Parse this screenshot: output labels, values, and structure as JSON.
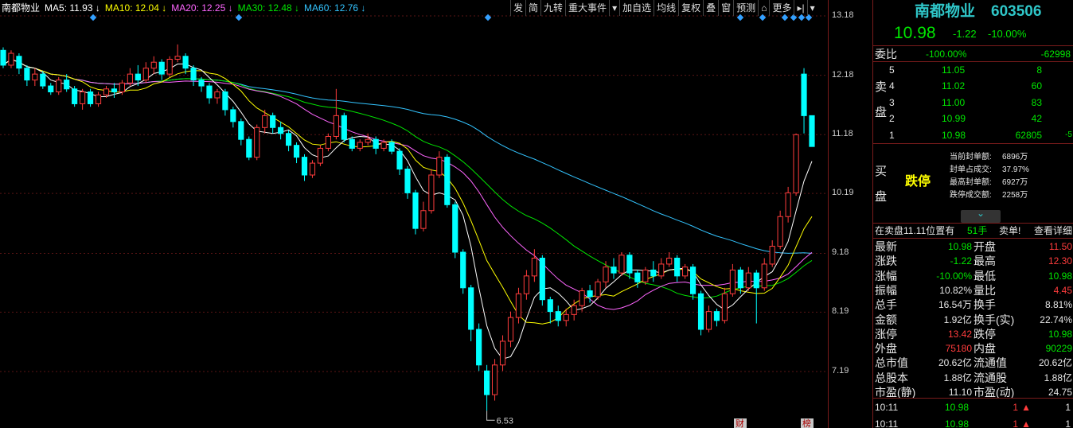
{
  "stock": {
    "name": "南都物业",
    "code": "603506",
    "price": "10.98",
    "change": "-1.22",
    "pct": "-10.00%"
  },
  "ma_legend": [
    {
      "label": "南都物业",
      "color": "#ffffff"
    },
    {
      "label": "MA5: 11.93",
      "color": "#ffffff",
      "arrow": "↓"
    },
    {
      "label": "MA10: 12.04",
      "color": "#ffff00",
      "arrow": "↓"
    },
    {
      "label": "MA20: 12.25",
      "color": "#ff66ff",
      "arrow": "↓"
    },
    {
      "label": "MA30: 12.48",
      "color": "#00e600",
      "arrow": "↓"
    },
    {
      "label": "MA60: 12.76",
      "color": "#33c4ff",
      "arrow": "↓"
    }
  ],
  "toolbar": [
    "发",
    "简",
    "九转",
    "重大事件",
    "▾",
    "加自选",
    "均线",
    "复权",
    "叠",
    "窗",
    "预测",
    "⌂",
    "更多",
    "▸|",
    "▾"
  ],
  "chart_data": {
    "type": "candlestick",
    "yticks": [
      "13.18",
      "12.18",
      "11.18",
      "10.19",
      "9.18",
      "8.19",
      "7.19"
    ],
    "low_label": "6.53",
    "bottom_marks": [
      "财",
      "榜"
    ],
    "candles": [
      [
        12.6,
        12.35,
        12.65,
        12.3
      ],
      [
        12.35,
        12.55,
        12.6,
        12.3
      ],
      [
        12.5,
        12.3,
        12.55,
        12.2
      ],
      [
        12.3,
        12.1,
        12.35,
        12.0
      ],
      [
        12.1,
        12.2,
        12.3,
        12.0
      ],
      [
        12.2,
        12.0,
        12.25,
        11.95
      ],
      [
        12.0,
        11.9,
        12.05,
        11.85
      ],
      [
        11.9,
        12.1,
        12.15,
        11.85
      ],
      [
        12.1,
        11.95,
        12.2,
        11.9
      ],
      [
        11.95,
        11.7,
        12.0,
        11.65
      ],
      [
        11.7,
        11.9,
        11.95,
        11.6
      ],
      [
        11.9,
        11.7,
        11.95,
        11.65
      ],
      [
        11.7,
        11.85,
        11.9,
        11.65
      ],
      [
        11.85,
        11.95,
        12.0,
        11.8
      ],
      [
        11.95,
        11.9,
        12.05,
        11.8
      ],
      [
        11.9,
        12.05,
        12.1,
        11.85
      ],
      [
        12.05,
        12.2,
        12.3,
        12.0
      ],
      [
        12.2,
        12.1,
        12.35,
        12.0
      ],
      [
        12.1,
        12.3,
        12.4,
        12.05
      ],
      [
        12.3,
        12.4,
        12.5,
        12.2
      ],
      [
        12.4,
        12.2,
        12.45,
        12.1
      ],
      [
        12.2,
        12.45,
        12.5,
        12.15
      ],
      [
        12.45,
        12.5,
        12.7,
        12.4
      ],
      [
        12.5,
        12.3,
        12.55,
        12.2
      ],
      [
        12.3,
        12.1,
        12.35,
        12.0
      ],
      [
        12.1,
        12.0,
        12.15,
        11.9
      ],
      [
        12.0,
        11.8,
        12.05,
        11.7
      ],
      [
        11.8,
        11.9,
        11.95,
        11.7
      ],
      [
        11.9,
        11.6,
        11.95,
        11.5
      ],
      [
        11.6,
        11.4,
        11.65,
        11.3
      ],
      [
        11.4,
        11.1,
        11.45,
        11.0
      ],
      [
        11.1,
        10.8,
        11.15,
        10.75
      ],
      [
        10.8,
        11.3,
        11.35,
        10.75
      ],
      [
        11.3,
        11.5,
        11.6,
        11.2
      ],
      [
        11.5,
        11.3,
        11.55,
        11.2
      ],
      [
        11.3,
        11.2,
        11.4,
        11.1
      ],
      [
        11.2,
        11.0,
        11.25,
        10.9
      ],
      [
        11.0,
        10.8,
        11.05,
        10.7
      ],
      [
        10.8,
        10.5,
        10.85,
        10.4
      ],
      [
        10.5,
        10.7,
        10.75,
        10.45
      ],
      [
        10.7,
        10.95,
        11.0,
        10.65
      ],
      [
        10.95,
        11.15,
        11.2,
        10.9
      ],
      [
        11.15,
        11.5,
        11.95,
        11.1
      ],
      [
        11.5,
        11.1,
        11.55,
        11.05
      ],
      [
        11.1,
        10.95,
        11.15,
        10.9
      ],
      [
        10.95,
        11.05,
        11.1,
        10.9
      ],
      [
        11.05,
        11.1,
        11.2,
        11.0
      ],
      [
        11.1,
        10.95,
        11.15,
        10.85
      ],
      [
        10.95,
        11.05,
        11.1,
        10.9
      ],
      [
        11.05,
        10.9,
        11.1,
        10.85
      ],
      [
        10.9,
        10.6,
        10.95,
        10.5
      ],
      [
        10.6,
        10.2,
        10.65,
        10.1
      ],
      [
        10.2,
        9.6,
        10.25,
        9.5
      ],
      [
        9.6,
        9.9,
        10.05,
        9.55
      ],
      [
        9.9,
        10.5,
        10.6,
        9.85
      ],
      [
        10.5,
        10.8,
        10.9,
        10.45
      ],
      [
        10.8,
        10.0,
        10.85,
        9.95
      ],
      [
        10.0,
        9.2,
        10.05,
        9.1
      ],
      [
        9.2,
        8.6,
        9.25,
        8.5
      ],
      [
        8.6,
        7.9,
        8.65,
        7.7
      ],
      [
        7.9,
        7.3,
        8.0,
        7.2
      ],
      [
        7.2,
        6.8,
        7.3,
        6.53
      ],
      [
        6.8,
        7.3,
        7.4,
        6.7
      ],
      [
        7.3,
        7.7,
        7.8,
        7.2
      ],
      [
        7.7,
        8.1,
        8.2,
        7.6
      ],
      [
        8.1,
        8.5,
        8.6,
        8.0
      ],
      [
        8.5,
        8.8,
        8.9,
        8.4
      ],
      [
        8.8,
        9.1,
        9.25,
        8.7
      ],
      [
        9.1,
        8.4,
        9.15,
        8.3
      ],
      [
        8.4,
        8.2,
        8.45,
        8.0
      ],
      [
        8.2,
        8.05,
        8.3,
        7.95
      ],
      [
        8.05,
        8.15,
        8.25,
        7.95
      ],
      [
        8.15,
        8.3,
        8.4,
        8.05
      ],
      [
        8.3,
        8.55,
        8.6,
        8.2
      ],
      [
        8.55,
        8.45,
        8.65,
        8.35
      ],
      [
        8.45,
        8.7,
        8.75,
        8.4
      ],
      [
        8.7,
        8.95,
        9.05,
        8.6
      ],
      [
        8.95,
        8.85,
        9.1,
        8.75
      ],
      [
        8.85,
        9.15,
        9.2,
        8.8
      ],
      [
        9.15,
        8.85,
        9.2,
        8.75
      ],
      [
        8.85,
        8.7,
        8.9,
        8.6
      ],
      [
        8.7,
        8.9,
        8.95,
        8.65
      ],
      [
        8.9,
        8.8,
        9.05,
        8.7
      ],
      [
        8.8,
        9.0,
        9.1,
        8.75
      ],
      [
        9.0,
        9.1,
        9.2,
        8.95
      ],
      [
        9.1,
        8.8,
        9.15,
        8.7
      ],
      [
        8.8,
        8.95,
        9.0,
        8.75
      ],
      [
        8.95,
        8.5,
        9.0,
        8.4
      ],
      [
        8.5,
        7.9,
        8.55,
        7.8
      ],
      [
        7.9,
        8.2,
        8.3,
        7.85
      ],
      [
        8.2,
        8.05,
        8.25,
        7.95
      ],
      [
        8.05,
        8.5,
        8.6,
        8.0
      ],
      [
        8.5,
        8.9,
        9.0,
        8.45
      ],
      [
        8.9,
        8.6,
        8.95,
        8.5
      ],
      [
        8.6,
        8.85,
        8.95,
        8.55
      ],
      [
        8.85,
        8.6,
        8.9,
        8.0
      ],
      [
        8.6,
        9.0,
        9.1,
        8.55
      ],
      [
        9.0,
        9.3,
        9.4,
        8.95
      ],
      [
        9.3,
        9.8,
        9.9,
        9.25
      ],
      [
        9.8,
        10.2,
        10.3,
        9.7
      ],
      [
        10.2,
        11.18,
        11.2,
        10.15
      ],
      [
        12.2,
        11.5,
        12.3,
        11.2
      ],
      [
        11.5,
        10.98,
        11.5,
        10.98
      ]
    ]
  },
  "panel": {
    "weibi_label": "委比",
    "weibi_pct": "-100.00%",
    "weibi_num": "-62998",
    "sell_label": [
      "卖",
      "盘"
    ],
    "buy_label": [
      "买",
      "盘"
    ],
    "asks": [
      {
        "lv": "5",
        "price": "11.05",
        "vol": "8",
        "extra": ""
      },
      {
        "lv": "4",
        "price": "11.02",
        "vol": "60",
        "extra": ""
      },
      {
        "lv": "3",
        "price": "11.00",
        "vol": "83",
        "extra": ""
      },
      {
        "lv": "2",
        "price": "10.99",
        "vol": "42",
        "extra": ""
      },
      {
        "lv": "1",
        "price": "10.98",
        "vol": "62805",
        "extra": "-5"
      }
    ],
    "limit_text": "跌停",
    "seal": [
      {
        "k": "当前封单额:",
        "v": "6896万"
      },
      {
        "k": "封单占成交:",
        "v": "37.97%"
      },
      {
        "k": "最高封单额:",
        "v": "6927万"
      },
      {
        "k": "跌停成交额:",
        "v": "2258万"
      }
    ],
    "sell_note": "在卖盘11.11位置有",
    "sell_note_vol": "51手",
    "sell_note_act": "卖单!",
    "detail_btn": "查看详细",
    "stats": [
      [
        "最新",
        "10.98",
        "grn",
        "开盘",
        "11.50",
        "red"
      ],
      [
        "涨跌",
        "-1.22",
        "grn",
        "最高",
        "12.30",
        "red"
      ],
      [
        "涨幅",
        "-10.00%",
        "grn",
        "最低",
        "10.98",
        "grn"
      ],
      [
        "振幅",
        "10.82%",
        "wht",
        "量比",
        "4.45",
        "red"
      ],
      [
        "总手",
        "16.54万",
        "wht",
        "换手",
        "8.81%",
        "wht"
      ],
      [
        "金额",
        "1.92亿",
        "wht",
        "换手(实)",
        "22.74%",
        "wht"
      ],
      [
        "涨停",
        "13.42",
        "red",
        "跌停",
        "10.98",
        "grn"
      ],
      [
        "外盘",
        "75180",
        "red",
        "内盘",
        "90229",
        "grn"
      ],
      [
        "总市值",
        "20.62亿",
        "wht",
        "流通值",
        "20.62亿",
        "wht"
      ],
      [
        "总股本",
        "1.88亿",
        "wht",
        "流通股",
        "1.88亿",
        "wht"
      ],
      [
        "市盈(静)",
        "11.10",
        "wht",
        "市盈(动)",
        "24.75",
        "wht"
      ]
    ],
    "ticks": [
      {
        "time": "10:11",
        "price": "10.98",
        "vol": "1",
        "n": "1"
      },
      {
        "time": "10:11",
        "price": "10.98",
        "vol": "1",
        "n": "1"
      }
    ]
  }
}
